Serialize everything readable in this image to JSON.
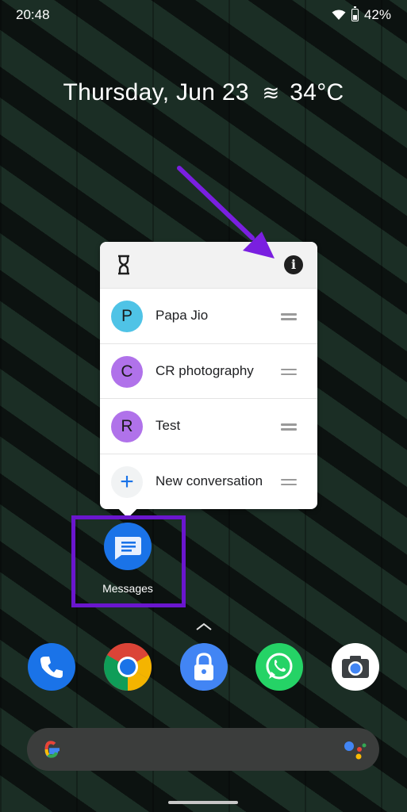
{
  "status_bar": {
    "time": "20:48",
    "battery": "42%",
    "icons": [
      "wifi-icon",
      "battery-icon"
    ]
  },
  "glance": {
    "date": "Thursday, Jun 23",
    "weather_icon": "haze-icon",
    "temperature": "34°C"
  },
  "popup": {
    "header_icons": [
      "hourglass-icon",
      "info-icon"
    ],
    "shortcuts": [
      {
        "initial": "P",
        "label": "Papa Jio",
        "color": "#4fc3e6"
      },
      {
        "initial": "C",
        "label": "CR photography",
        "color": "#b072ea"
      },
      {
        "initial": "R",
        "label": "Test",
        "color": "#b072ea"
      },
      {
        "initial": "+",
        "label": "New conversation",
        "color": "#1a73e8"
      }
    ]
  },
  "app": {
    "label": "Messages",
    "highlight_color": "#6a16ce",
    "annotation_arrow_color": "#7a1fe0"
  },
  "dock": [
    {
      "name": "phone",
      "icon": "phone-icon",
      "color": "#1a73e8"
    },
    {
      "name": "chrome",
      "icon": "chrome-icon"
    },
    {
      "name": "app-lock",
      "icon": "lock-icon",
      "color": "#4285f4"
    },
    {
      "name": "whatsapp",
      "icon": "whatsapp-icon",
      "color": "#25d366"
    },
    {
      "name": "camera",
      "icon": "camera-icon"
    }
  ],
  "search": {
    "left_icon": "google-logo-icon",
    "right_icon": "google-assistant-icon"
  }
}
